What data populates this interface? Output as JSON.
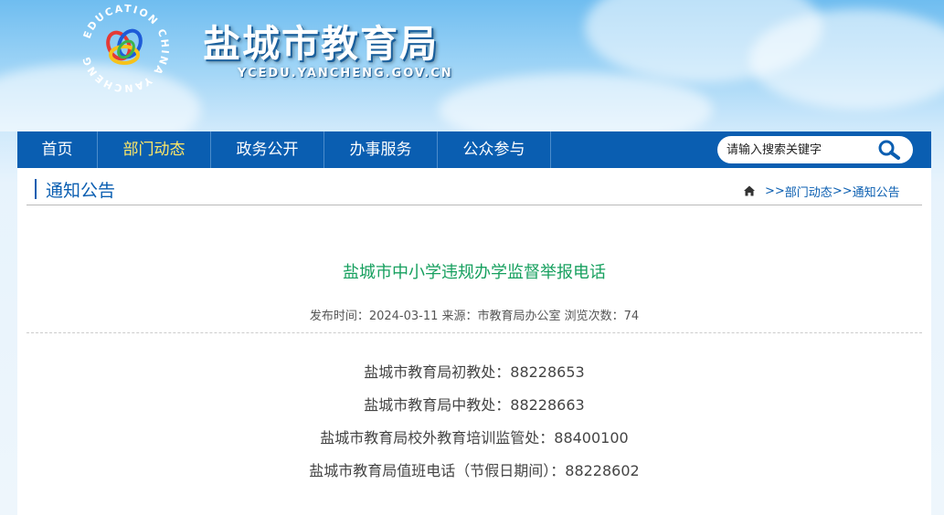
{
  "header": {
    "title": "盐城市教育局",
    "url": "YCEDU.YANCHENG.GOV.CN",
    "logo_ring_text": "EDUCATION CHINA YANCHENG"
  },
  "nav": {
    "items": [
      {
        "label": "首页",
        "active": false
      },
      {
        "label": "部门动态",
        "active": true
      },
      {
        "label": "政务公开",
        "active": false
      },
      {
        "label": "办事服务",
        "active": false
      },
      {
        "label": "公众参与",
        "active": false
      }
    ],
    "search_placeholder": "请输入搜索关键字"
  },
  "section": {
    "title": "通知公告",
    "breadcrumb": {
      "sep1": ">>",
      "item1": "部门动态",
      "sep2": ">>",
      "item2": "通知公告"
    }
  },
  "article": {
    "title": "盐城市中小学违规办学监督举报电话",
    "meta": "发布时间：2024-03-11 来源：市教育局办公室 浏览次数：74",
    "lines": [
      "盐城市教育局初教处：88228653",
      "盐城市教育局中教处：88228663",
      "盐城市教育局校外教育培训监管处：88400100",
      "盐城市教育局值班电话（节假日期间）：88228602"
    ]
  },
  "colors": {
    "nav_bg": "#0a5eb1",
    "nav_active": "#ffe867",
    "title_green": "#17a05f",
    "accent_blue": "#0a5eb1"
  },
  "icons": [
    "logo-emblem",
    "search-icon",
    "home-icon"
  ]
}
